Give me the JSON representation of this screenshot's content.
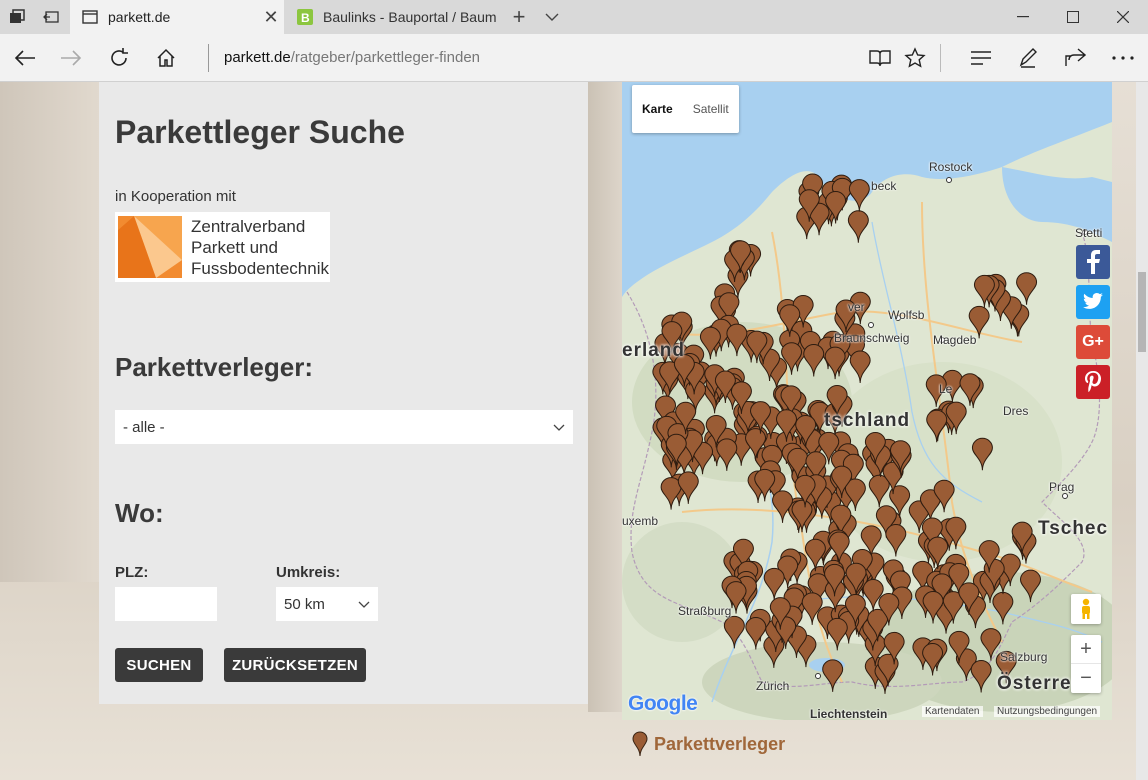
{
  "browser": {
    "tabs": [
      {
        "label": "parkett.de",
        "active": true
      },
      {
        "label": "Baulinks - Bauportal / Baum",
        "active": false
      }
    ],
    "url": {
      "host": "parkett.de",
      "path": "/ratgeber/parkettleger-finden"
    }
  },
  "page": {
    "title": "Parkettleger Suche",
    "cooperation_text": "in Kooperation mit",
    "logo": {
      "line1": "Zentralverband",
      "line2": "Parkett und",
      "line3": "Fussbodentechnik"
    },
    "verleger": {
      "heading": "Parkettverleger:",
      "selected": "- alle -"
    },
    "wo": {
      "heading": "Wo:",
      "plz_label": "PLZ:",
      "plz_value": "",
      "umkreis_label": "Umkreis:",
      "umkreis_selected": "50 km"
    },
    "buttons": {
      "search": "SUCHEN",
      "reset": "ZURÜCKSETZEN"
    }
  },
  "map": {
    "type_buttons": {
      "map": "Karte",
      "satellite": "Satellit"
    },
    "cities": {
      "rostock": "Rostock",
      "luebeck": "beck",
      "stettin": "Stetti",
      "hannover": "ver",
      "wolfsburg": "Wolfsb",
      "braunschweig": "Braunschweig",
      "magdeburg": "Magdeb",
      "leipzig": "Le",
      "dresden": "Dres",
      "prag": "Prag",
      "luxemburg": "uxemb",
      "strassburg": "Straßburg",
      "zuerich": "Zürich",
      "salzburg": "Salzburg",
      "liechtenstein": "Liechtenstein"
    },
    "countries": {
      "niederlande": "erland",
      "deutschland": "tschland",
      "tschechien": "Tschec",
      "oesterreich": "Österre"
    },
    "google_logo": "Google",
    "attribution": {
      "data": "Kartendaten",
      "terms": "Nutzungsbedingungen"
    },
    "zoom": {
      "in": "+",
      "out": "−"
    },
    "legend": "Parkettverleger",
    "marker_color": "#9a5c35"
  },
  "social": {
    "facebook": "f",
    "twitter": "t",
    "googleplus": "G+",
    "pinterest": "P"
  }
}
